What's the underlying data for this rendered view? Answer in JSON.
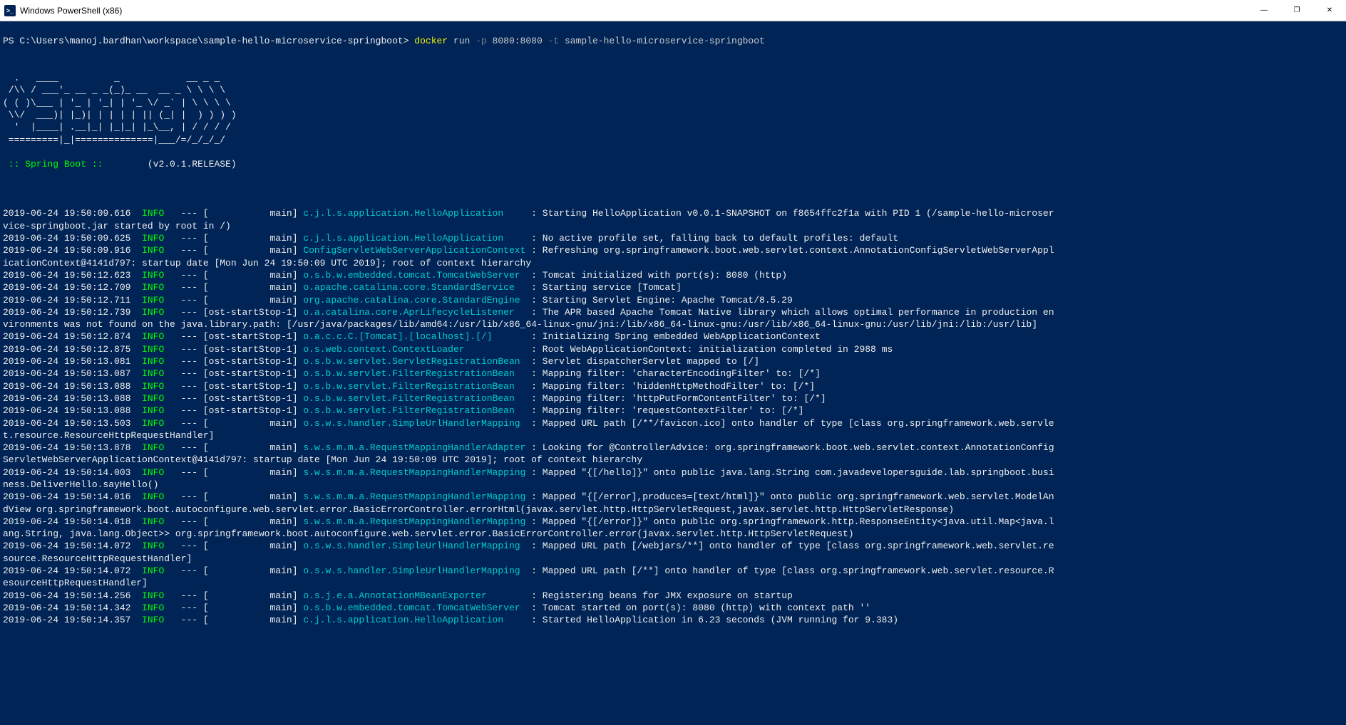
{
  "titlebar": {
    "title": "Windows PowerShell (x86)",
    "minimize": "—",
    "maximize": "❐",
    "close": "✕"
  },
  "prompt": {
    "path": "PS C:\\Users\\manoj.bardhan\\workspace\\sample-hello-microservice-springboot> ",
    "cmd_docker": "docker",
    "cmd_run": " run ",
    "cmd_flag1": "-p",
    "cmd_portarg": " 8080:8080 ",
    "cmd_flag2": "-t",
    "cmd_image": " sample-hello-microservice-springboot"
  },
  "ascii": [
    "",
    "  .   ____          _            __ _ _",
    " /\\\\ / ___'_ __ _ _(_)_ __  __ _ \\ \\ \\ \\",
    "( ( )\\___ | '_ | '_| | '_ \\/ _` | \\ \\ \\ \\",
    " \\\\/  ___)| |_)| | | | | || (_| |  ) ) ) )",
    "  '  |____| .__|_| |_|_| |_\\__, | / / / /",
    " =========|_|==============|___/=/_/_/_/"
  ],
  "spring_line": {
    "left": " :: Spring Boot ::        ",
    "version": "(v2.0.1.RELEASE)"
  },
  "logs": [
    {
      "ts": "2019-06-24 19:50:09.616",
      "level": "INFO",
      "pid": "---",
      "thread": "[           main]",
      "logger": "c.j.l.s.application.HelloApplication    ",
      "msg": ": Starting HelloApplication v0.0.1-SNAPSHOT on f8654ffc2f1a with PID 1 (/sample-hello-microser"
    },
    {
      "cont": "vice-springboot.jar started by root in /)"
    },
    {
      "ts": "2019-06-24 19:50:09.625",
      "level": "INFO",
      "pid": "---",
      "thread": "[           main]",
      "logger": "c.j.l.s.application.HelloApplication    ",
      "msg": ": No active profile set, falling back to default profiles: default"
    },
    {
      "ts": "2019-06-24 19:50:09.916",
      "level": "INFO",
      "pid": "---",
      "thread": "[           main]",
      "logger": "ConfigServletWebServerApplicationContext",
      "msg": ": Refreshing org.springframework.boot.web.servlet.context.AnnotationConfigServletWebServerAppl"
    },
    {
      "cont": "icationContext@4141d797: startup date [Mon Jun 24 19:50:09 UTC 2019]; root of context hierarchy"
    },
    {
      "ts": "2019-06-24 19:50:12.623",
      "level": "INFO",
      "pid": "---",
      "thread": "[           main]",
      "logger": "o.s.b.w.embedded.tomcat.TomcatWebServer ",
      "msg": ": Tomcat initialized with port(s): 8080 (http)"
    },
    {
      "ts": "2019-06-24 19:50:12.709",
      "level": "INFO",
      "pid": "---",
      "thread": "[           main]",
      "logger": "o.apache.catalina.core.StandardService  ",
      "msg": ": Starting service [Tomcat]"
    },
    {
      "ts": "2019-06-24 19:50:12.711",
      "level": "INFO",
      "pid": "---",
      "thread": "[           main]",
      "logger": "org.apache.catalina.core.StandardEngine ",
      "msg": ": Starting Servlet Engine: Apache Tomcat/8.5.29"
    },
    {
      "ts": "2019-06-24 19:50:12.739",
      "level": "INFO",
      "pid": "---",
      "thread": "[ost-startStop-1]",
      "logger": "o.a.catalina.core.AprLifecycleListener  ",
      "msg": ": The APR based Apache Tomcat Native library which allows optimal performance in production en"
    },
    {
      "cont": "vironments was not found on the java.library.path: [/usr/java/packages/lib/amd64:/usr/lib/x86_64-linux-gnu/jni:/lib/x86_64-linux-gnu:/usr/lib/x86_64-linux-gnu:/usr/lib/jni:/lib:/usr/lib]"
    },
    {
      "ts": "2019-06-24 19:50:12.874",
      "level": "INFO",
      "pid": "---",
      "thread": "[ost-startStop-1]",
      "logger": "o.a.c.c.C.[Tomcat].[localhost].[/]      ",
      "msg": ": Initializing Spring embedded WebApplicationContext"
    },
    {
      "ts": "2019-06-24 19:50:12.875",
      "level": "INFO",
      "pid": "---",
      "thread": "[ost-startStop-1]",
      "logger": "o.s.web.context.ContextLoader           ",
      "msg": ": Root WebApplicationContext: initialization completed in 2988 ms"
    },
    {
      "ts": "2019-06-24 19:50:13.081",
      "level": "INFO",
      "pid": "---",
      "thread": "[ost-startStop-1]",
      "logger": "o.s.b.w.servlet.ServletRegistrationBean ",
      "msg": ": Servlet dispatcherServlet mapped to [/]"
    },
    {
      "ts": "2019-06-24 19:50:13.087",
      "level": "INFO",
      "pid": "---",
      "thread": "[ost-startStop-1]",
      "logger": "o.s.b.w.servlet.FilterRegistrationBean  ",
      "msg": ": Mapping filter: 'characterEncodingFilter' to: [/*]"
    },
    {
      "ts": "2019-06-24 19:50:13.088",
      "level": "INFO",
      "pid": "---",
      "thread": "[ost-startStop-1]",
      "logger": "o.s.b.w.servlet.FilterRegistrationBean  ",
      "msg": ": Mapping filter: 'hiddenHttpMethodFilter' to: [/*]"
    },
    {
      "ts": "2019-06-24 19:50:13.088",
      "level": "INFO",
      "pid": "---",
      "thread": "[ost-startStop-1]",
      "logger": "o.s.b.w.servlet.FilterRegistrationBean  ",
      "msg": ": Mapping filter: 'httpPutFormContentFilter' to: [/*]"
    },
    {
      "ts": "2019-06-24 19:50:13.088",
      "level": "INFO",
      "pid": "---",
      "thread": "[ost-startStop-1]",
      "logger": "o.s.b.w.servlet.FilterRegistrationBean  ",
      "msg": ": Mapping filter: 'requestContextFilter' to: [/*]"
    },
    {
      "ts": "2019-06-24 19:50:13.503",
      "level": "INFO",
      "pid": "---",
      "thread": "[           main]",
      "logger": "o.s.w.s.handler.SimpleUrlHandlerMapping ",
      "msg": ": Mapped URL path [/**/favicon.ico] onto handler of type [class org.springframework.web.servle"
    },
    {
      "cont": "t.resource.ResourceHttpRequestHandler]"
    },
    {
      "ts": "2019-06-24 19:50:13.878",
      "level": "INFO",
      "pid": "---",
      "thread": "[           main]",
      "logger": "s.w.s.m.m.a.RequestMappingHandlerAdapter",
      "msg": ": Looking for @ControllerAdvice: org.springframework.boot.web.servlet.context.AnnotationConfig"
    },
    {
      "cont": "ServletWebServerApplicationContext@4141d797: startup date [Mon Jun 24 19:50:09 UTC 2019]; root of context hierarchy"
    },
    {
      "ts": "2019-06-24 19:50:14.003",
      "level": "INFO",
      "pid": "---",
      "thread": "[           main]",
      "logger": "s.w.s.m.m.a.RequestMappingHandlerMapping",
      "msg": ": Mapped \"{[/hello]}\" onto public java.lang.String com.javadevelopersguide.lab.springboot.busi"
    },
    {
      "cont": "ness.DeliverHello.sayHello()"
    },
    {
      "ts": "2019-06-24 19:50:14.016",
      "level": "INFO",
      "pid": "---",
      "thread": "[           main]",
      "logger": "s.w.s.m.m.a.RequestMappingHandlerMapping",
      "msg": ": Mapped \"{[/error],produces=[text/html]}\" onto public org.springframework.web.servlet.ModelAn"
    },
    {
      "cont": "dView org.springframework.boot.autoconfigure.web.servlet.error.BasicErrorController.errorHtml(javax.servlet.http.HttpServletRequest,javax.servlet.http.HttpServletResponse)"
    },
    {
      "ts": "2019-06-24 19:50:14.018",
      "level": "INFO",
      "pid": "---",
      "thread": "[           main]",
      "logger": "s.w.s.m.m.a.RequestMappingHandlerMapping",
      "msg": ": Mapped \"{[/error]}\" onto public org.springframework.http.ResponseEntity<java.util.Map<java.l"
    },
    {
      "cont": "ang.String, java.lang.Object>> org.springframework.boot.autoconfigure.web.servlet.error.BasicErrorController.error(javax.servlet.http.HttpServletRequest)"
    },
    {
      "ts": "2019-06-24 19:50:14.072",
      "level": "INFO",
      "pid": "---",
      "thread": "[           main]",
      "logger": "o.s.w.s.handler.SimpleUrlHandlerMapping ",
      "msg": ": Mapped URL path [/webjars/**] onto handler of type [class org.springframework.web.servlet.re"
    },
    {
      "cont": "source.ResourceHttpRequestHandler]"
    },
    {
      "ts": "2019-06-24 19:50:14.072",
      "level": "INFO",
      "pid": "---",
      "thread": "[           main]",
      "logger": "o.s.w.s.handler.SimpleUrlHandlerMapping ",
      "msg": ": Mapped URL path [/**] onto handler of type [class org.springframework.web.servlet.resource.R"
    },
    {
      "cont": "esourceHttpRequestHandler]"
    },
    {
      "ts": "2019-06-24 19:50:14.256",
      "level": "INFO",
      "pid": "---",
      "thread": "[           main]",
      "logger": "o.s.j.e.a.AnnotationMBeanExporter       ",
      "msg": ": Registering beans for JMX exposure on startup"
    },
    {
      "ts": "2019-06-24 19:50:14.342",
      "level": "INFO",
      "pid": "---",
      "thread": "[           main]",
      "logger": "o.s.b.w.embedded.tomcat.TomcatWebServer ",
      "msg": ": Tomcat started on port(s): 8080 (http) with context path ''"
    },
    {
      "ts": "2019-06-24 19:50:14.357",
      "level": "INFO",
      "pid": "---",
      "thread": "[           main]",
      "logger": "c.j.l.s.application.HelloApplication    ",
      "msg": ": Started HelloApplication in 6.23 seconds (JVM running for 9.383)"
    }
  ]
}
